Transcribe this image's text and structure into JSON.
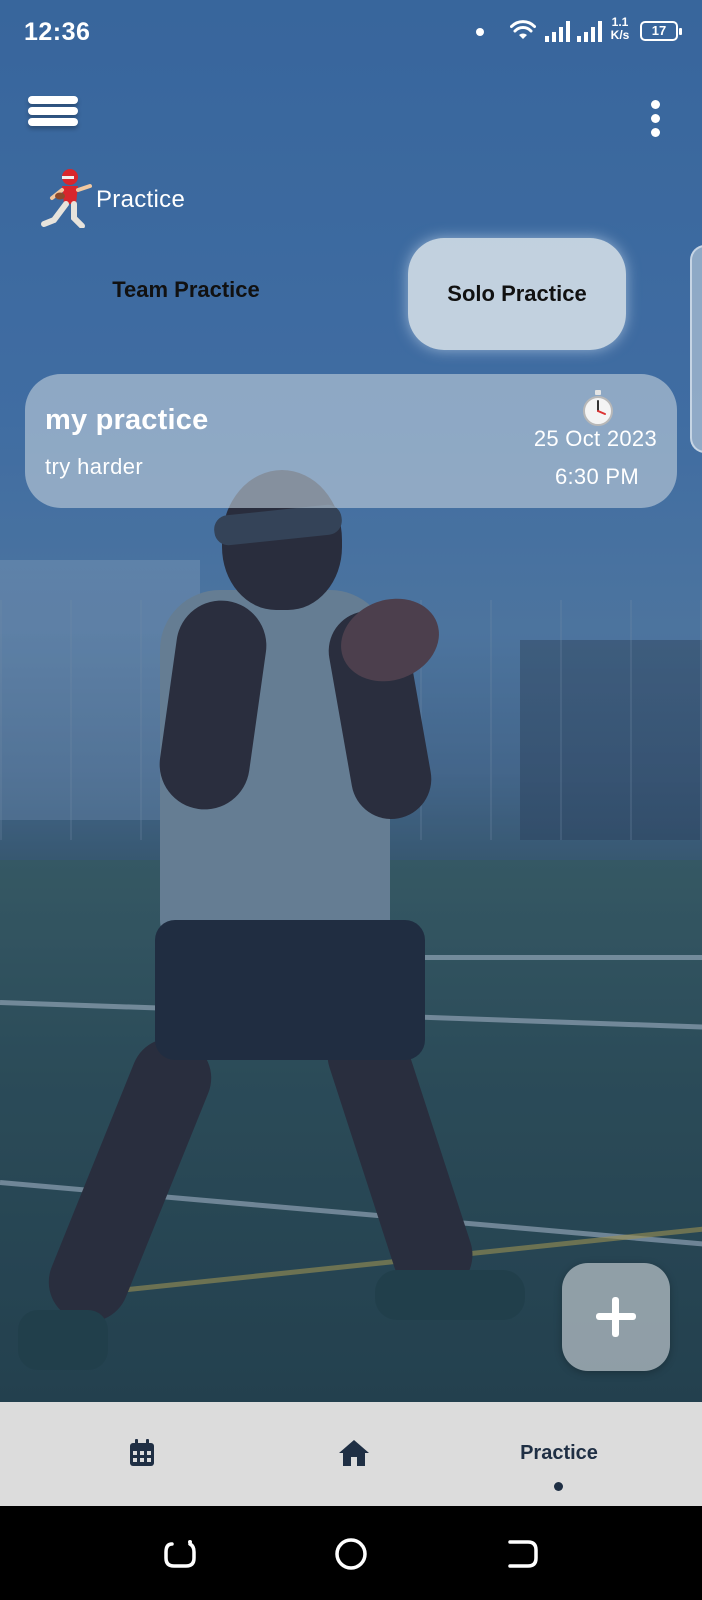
{
  "status_bar": {
    "time": "12:36",
    "net_speed_value": "1.1",
    "net_speed_unit": "K/s",
    "battery": "17",
    "icons": [
      "notification-dot-icon",
      "wifi-icon",
      "signal-icon",
      "signal-icon",
      "battery-icon"
    ]
  },
  "app_bar": {
    "menu_icon": "hamburger-menu-icon",
    "more_icon": "more-vertical-icon"
  },
  "page": {
    "title": "Practice",
    "title_icon": "football-runner-icon"
  },
  "tabs": [
    {
      "label": "Team Practice",
      "selected": false
    },
    {
      "label": "Solo Practice",
      "selected": true
    }
  ],
  "practices": [
    {
      "name": "my practice",
      "description": "try harder",
      "date": "25 Oct 2023",
      "time": "6:30 PM",
      "icon": "stopwatch-icon"
    }
  ],
  "fab": {
    "icon": "plus-icon"
  },
  "bottom_nav": {
    "items": [
      {
        "icon": "calendar-icon",
        "label": ""
      },
      {
        "icon": "home-icon",
        "label": ""
      },
      {
        "icon": "",
        "label": "Practice",
        "active": true
      }
    ]
  },
  "colors": {
    "nav_background": "#dcdcdc",
    "nav_text": "#1f2f44",
    "selected_tab_bg": "#cddae4",
    "card_bg": "#becdda"
  }
}
